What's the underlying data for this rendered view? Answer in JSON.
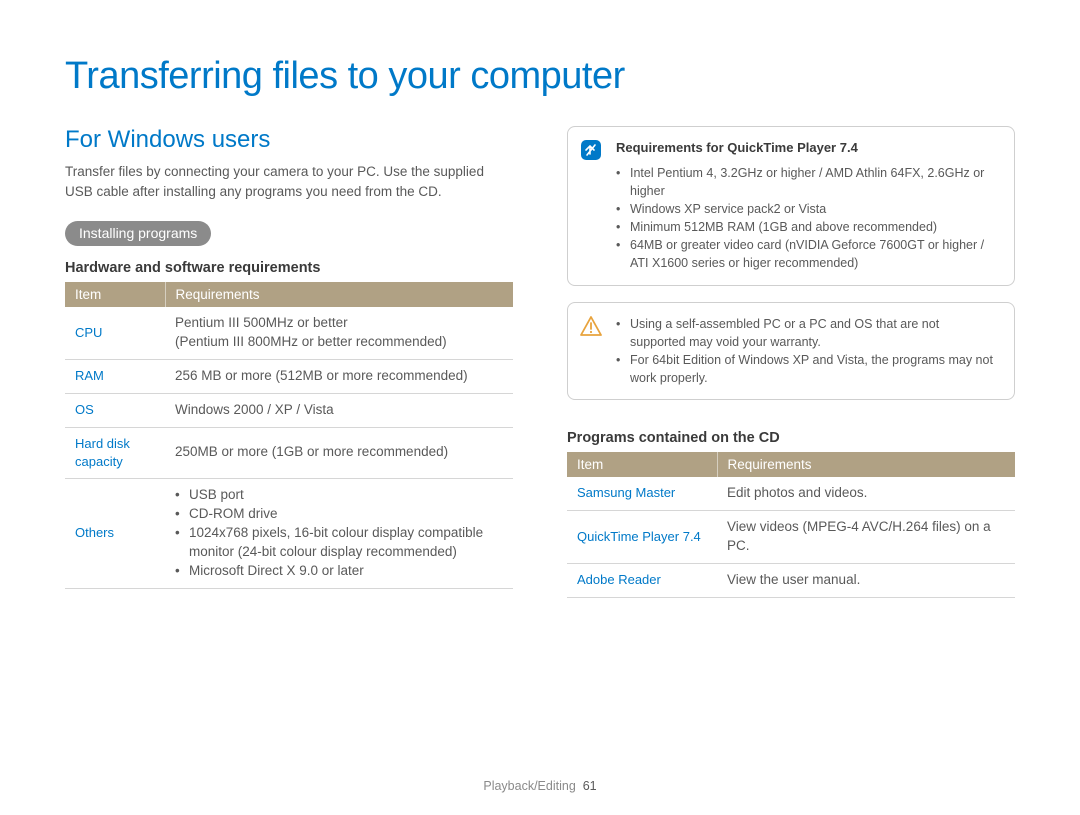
{
  "title": "Transferring files to your computer",
  "left": {
    "heading": "For Windows users",
    "intro": "Transfer files by connecting your camera to your PC. Use the supplied USB cable after installing any programs you need from the CD.",
    "pill": "Installing programs",
    "subheading": "Hardware and software requirements",
    "table": {
      "head": {
        "c1": "Item",
        "c2": "Requirements"
      },
      "rows": {
        "cpu": {
          "item": "CPU",
          "req_l1": "Pentium III 500MHz or better",
          "req_l2": "(Pentium III 800MHz or better recommended)"
        },
        "ram": {
          "item": "RAM",
          "req": "256 MB or more (512MB or more recommended)"
        },
        "os": {
          "item": "OS",
          "req": "Windows 2000 / XP / Vista"
        },
        "hd": {
          "item": "Hard disk capacity",
          "req": "250MB or more (1GB or more recommended)"
        },
        "others": {
          "item": "Others",
          "b1": "USB port",
          "b2": "CD-ROM drive",
          "b3": "1024x768 pixels, 16-bit colour display compatible monitor (24-bit colour display recommended)",
          "b4": "Microsoft Direct X 9.0 or later"
        }
      }
    }
  },
  "right": {
    "notebox": {
      "title": "Requirements for QuickTime Player 7.4",
      "b1": "Intel Pentium 4, 3.2GHz or higher / AMD Athlin 64FX, 2.6GHz or higher",
      "b2": "Windows XP service pack2 or Vista",
      "b3": "Minimum 512MB RAM (1GB and above recommended)",
      "b4": "64MB or greater video card (nVIDIA Geforce 7600GT or higher / ATI X1600 series or higer recommended)"
    },
    "warnbox": {
      "b1": "Using a self-assembled PC or a PC and OS that are not supported may void your warranty.",
      "b2": "For 64bit Edition of Windows XP and Vista, the programs may not work properly."
    },
    "subheading": "Programs contained on the CD",
    "table": {
      "head": {
        "c1": "Item",
        "c2": "Requirements"
      },
      "rows": {
        "sm": {
          "item": "Samsung Master",
          "req": "Edit photos and videos."
        },
        "qt": {
          "item": "QuickTime Player 7.4",
          "req": "View videos (MPEG-4 AVC/H.264 files) on a PC."
        },
        "ar": {
          "item": "Adobe Reader",
          "req": "View the user manual."
        }
      }
    }
  },
  "footer": {
    "section": "Playback/Editing",
    "page": "61"
  }
}
